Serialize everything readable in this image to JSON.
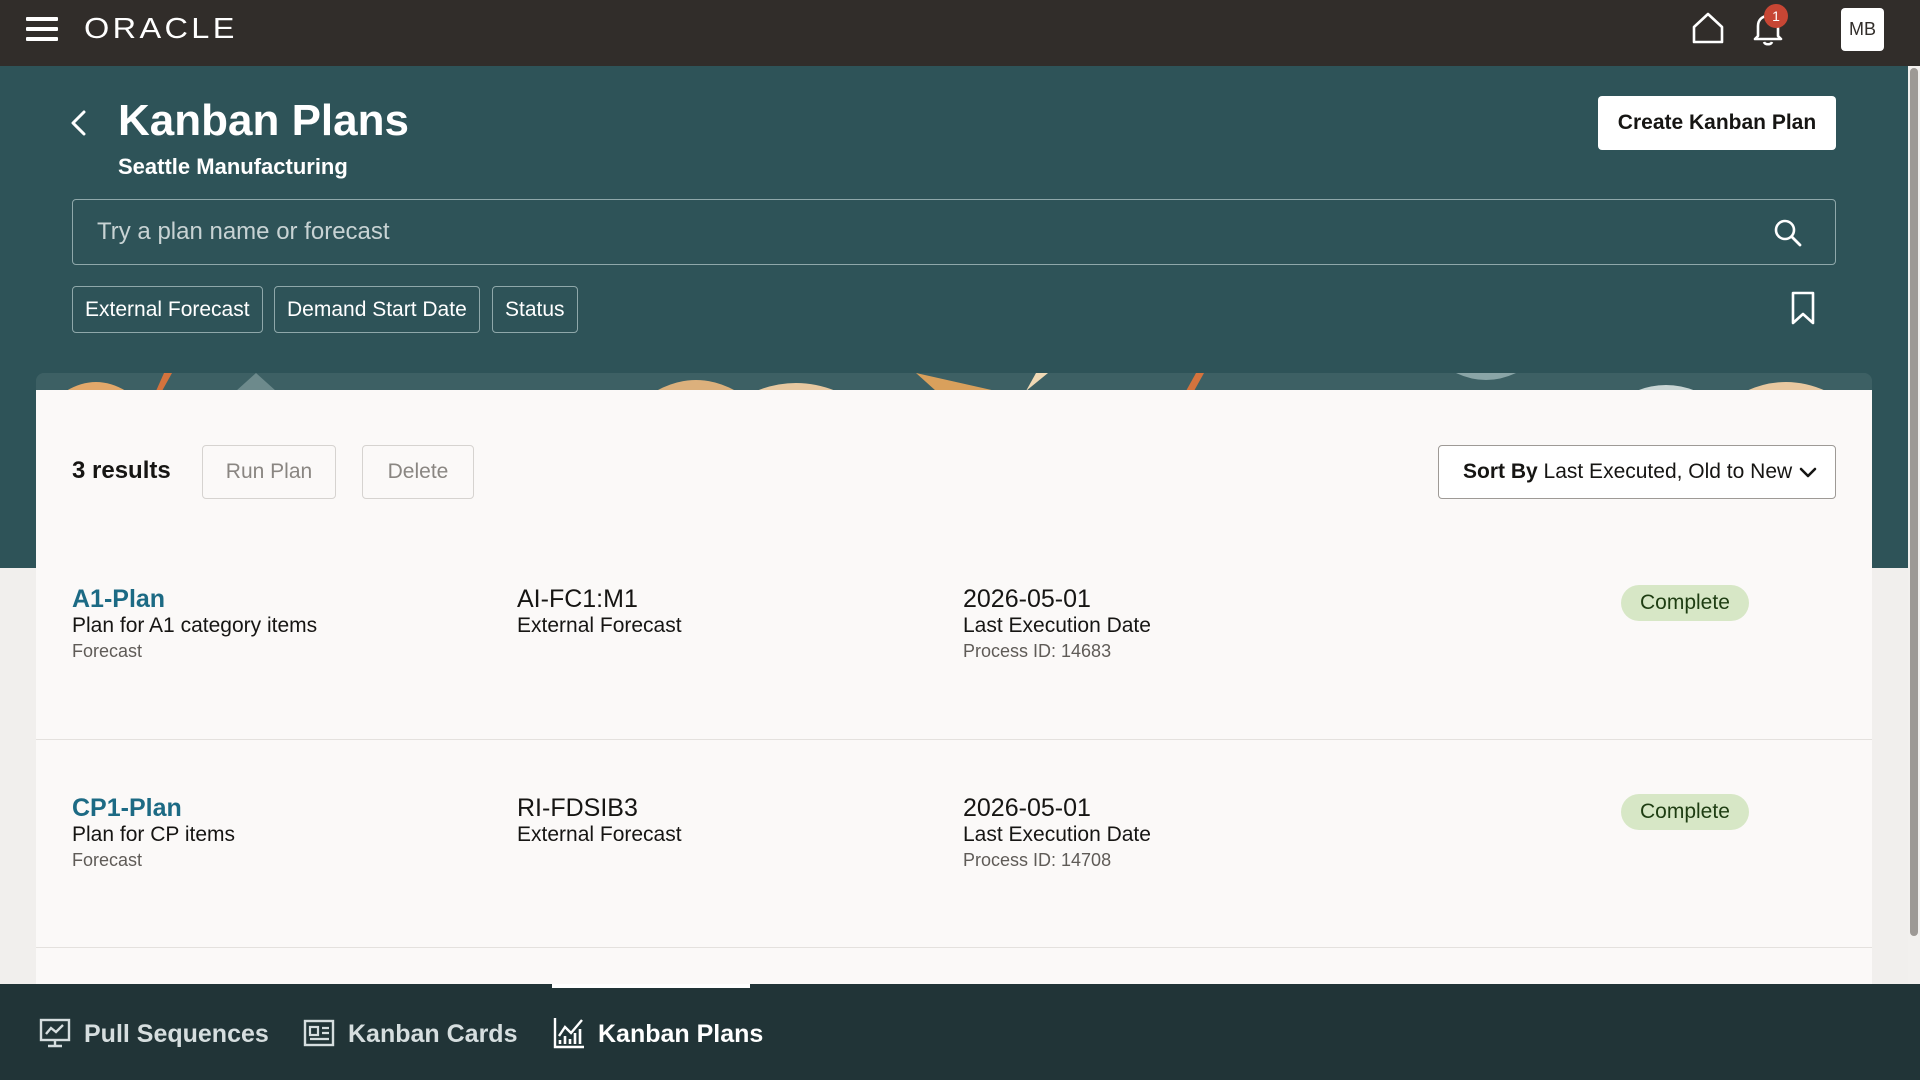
{
  "topbar": {
    "brand": "ORACLE",
    "notification_count": "1",
    "avatar_initials": "MB"
  },
  "header": {
    "title": "Kanban Plans",
    "subtitle": "Seattle Manufacturing",
    "create_label": "Create Kanban Plan",
    "search_placeholder": "Try a plan name or forecast",
    "filters": [
      "External Forecast",
      "Demand Start Date",
      "Status"
    ]
  },
  "toolbar": {
    "results": "3 results",
    "run_label": "Run Plan",
    "delete_label": "Delete",
    "sort_prefix": "Sort By",
    "sort_value": "Last Executed, Old to New"
  },
  "plans": [
    {
      "name": "A1-Plan",
      "description": "Plan for A1 category items",
      "type": "Forecast",
      "forecast": "AI-FC1:M1",
      "forecast_label": "External Forecast",
      "date": "2026-05-01",
      "date_label": "Last Execution Date",
      "process": "Process ID: 14683",
      "status": "Complete"
    },
    {
      "name": "CP1-Plan",
      "description": "Plan for CP items",
      "type": "Forecast",
      "forecast": "RI-FDSIB3",
      "forecast_label": "External Forecast",
      "date": "2026-05-01",
      "date_label": "Last Execution Date",
      "process": "Process ID: 14708",
      "status": "Complete"
    }
  ],
  "bottom_nav": {
    "items": [
      "Pull Sequences",
      "Kanban Cards",
      "Kanban Plans"
    ],
    "active": "Kanban Plans"
  },
  "colors": {
    "topbar": "#312d2a",
    "header": "#2e5358",
    "link": "#1c6a84",
    "status_bg": "#d7e7c6",
    "bottom_nav": "#213437",
    "badge": "#c74634"
  }
}
